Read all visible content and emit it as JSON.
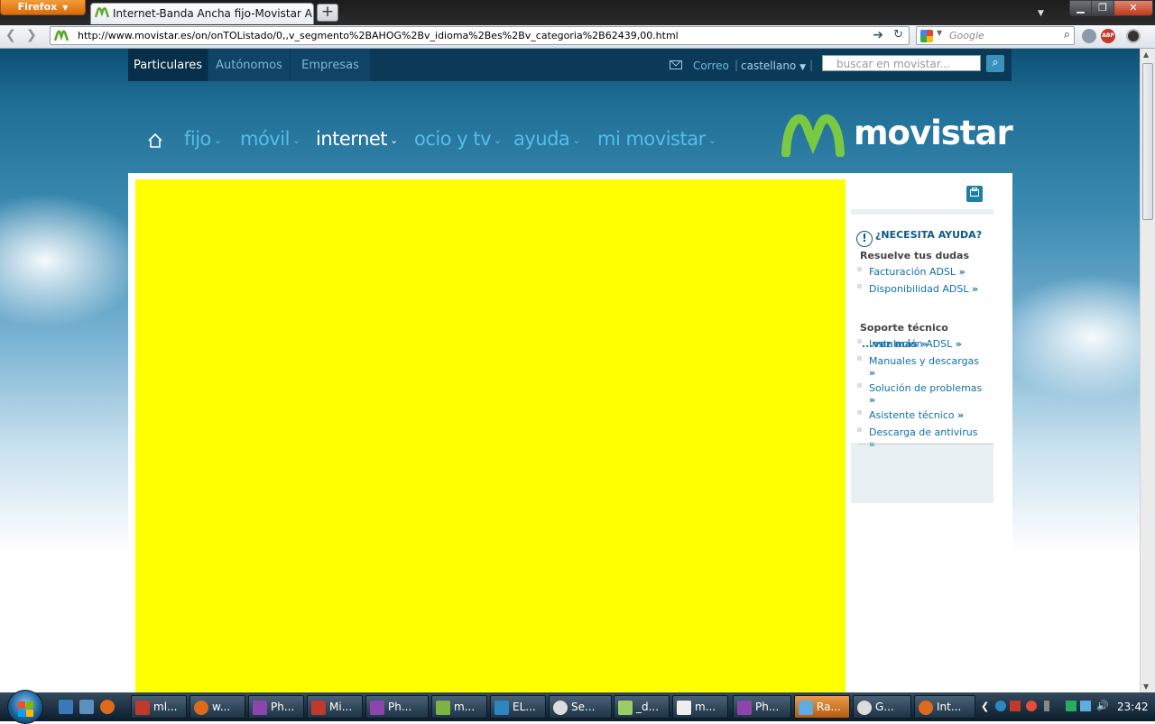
{
  "browser": {
    "app_button": "Firefox",
    "tab_title": "Internet-Banda Ancha fijo-Movistar ADS...",
    "new_tab": "+",
    "url": "http://www.movistar.es/on/onTOListado/0,,v_segmento%2BAHOG%2Bv_idioma%2Bes%2Bv_categoria%2B62439,00.html",
    "search_engine": "Google",
    "search_placeholder": "Google"
  },
  "site": {
    "segments": [
      "Particulares",
      "Autónomos",
      "Empresas"
    ],
    "correo": "Correo",
    "language": "castellano",
    "search_placeholder": "buscar en movistar...",
    "logo_text": "movistar",
    "nav": [
      {
        "label": "fijo"
      },
      {
        "label": "móvil"
      },
      {
        "label": "internet"
      },
      {
        "label": "ocio y tv"
      },
      {
        "label": "ayuda"
      },
      {
        "label": "mi movistar"
      }
    ],
    "help": {
      "title": "¿NECESITA AYUDA?",
      "section1": "Resuelve tus dudas",
      "links1": [
        "Facturación ADSL",
        "Disponibilidad ADSL"
      ],
      "ver_mas": "...ver más",
      "section2": "Soporte técnico",
      "links2": [
        "Instalación ADSL",
        "Manuales y descargas",
        "Solución de problemas",
        "Asistente técnico",
        "Descarga de antivirus"
      ]
    }
  },
  "taskbar": {
    "items": [
      "ml...",
      "w...",
      "Ph...",
      "Mi...",
      "Ph...",
      "m...",
      "EL...",
      "Se...",
      "_d...",
      "m...",
      "Ph...",
      "Ra...",
      "G...",
      "Int..."
    ],
    "clock": "23:42"
  },
  "colors": {
    "ad_yellow": "#ffff00",
    "brand_green": "#7ac943",
    "nav_blue": "#56bde8"
  }
}
